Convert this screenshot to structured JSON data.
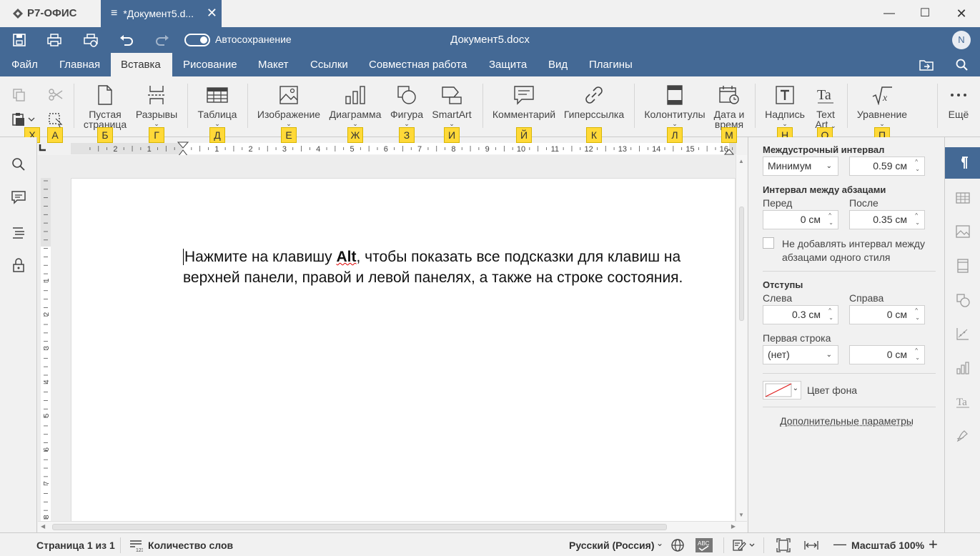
{
  "app": {
    "brand": "Р7-ОФИС",
    "tab_title": "*Документ5.d...",
    "doc_title": "Документ5.docx",
    "avatar": "N",
    "autosave_label": "Автосохранение"
  },
  "menu": [
    "Файл",
    "Главная",
    "Вставка",
    "Рисование",
    "Макет",
    "Ссылки",
    "Совместная работа",
    "Защита",
    "Вид",
    "Плагины"
  ],
  "menu_active": "Вставка",
  "ribbon": {
    "blank_page": [
      "Пустая",
      "страница"
    ],
    "breaks": "Разрывы",
    "table": "Таблица",
    "image": "Изображение",
    "chart": "Диаграмма",
    "shape": "Фигура",
    "smartart": "SmartArt",
    "comment": "Комментарий",
    "hyperlink": "Гиперссылка",
    "headers": "Колонтитулы",
    "datetime": [
      "Дата и",
      "время"
    ],
    "textbox": "Надпись",
    "textart": [
      "Text",
      "Art"
    ],
    "equation": "Уравнение",
    "more": "Ещё"
  },
  "hints": [
    "Х",
    "А",
    "Б",
    "Г",
    "Д",
    "Е",
    "Ж",
    "З",
    "И",
    "Й",
    "К",
    "Л",
    "М",
    "Н",
    "О",
    "П"
  ],
  "document": {
    "text_before": "Нажмите на клавишу ",
    "text_bold": "Alt",
    "text_after": ", чтобы показать все подсказки для клавиш на верхней панели, правой и левой панелях, а также на строке состояния."
  },
  "ruler": {
    "left_numbers": [
      "2",
      "1"
    ],
    "numbers": [
      "1",
      "2",
      "3",
      "4",
      "5",
      "6",
      "7",
      "8",
      "9",
      "10",
      "11",
      "12",
      "13",
      "14",
      "15",
      "16"
    ],
    "v_numbers": [
      "1",
      "2",
      "3",
      "4",
      "5",
      "6",
      "7",
      "8"
    ]
  },
  "panel": {
    "line_spacing_title": "Междустрочный интервал",
    "line_spacing_type": "Минимум",
    "line_spacing_value": "0.59 см",
    "para_spacing_title": "Интервал между абзацами",
    "before_label": "Перед",
    "after_label": "После",
    "before_value": "0 см",
    "after_value": "0.35 см",
    "no_interval_label": [
      "Не добавлять интервал между",
      "абзацами одного стиля"
    ],
    "indents_title": "Отступы",
    "left_label": "Слева",
    "right_label": "Справа",
    "left_value": "0.3 см",
    "right_value": "0 см",
    "first_line_label": "Первая строка",
    "first_line_type": "(нет)",
    "first_line_value": "0 см",
    "bg_color_label": "Цвет фона",
    "advanced_link": "Дополнительные параметры"
  },
  "status": {
    "page": "Страница 1 из 1",
    "word_count": "Количество слов",
    "language": "Русский (Россия)",
    "zoom": "Масштаб 100%"
  },
  "colors": {
    "accent": "#446995",
    "hint": "#ffd938"
  }
}
